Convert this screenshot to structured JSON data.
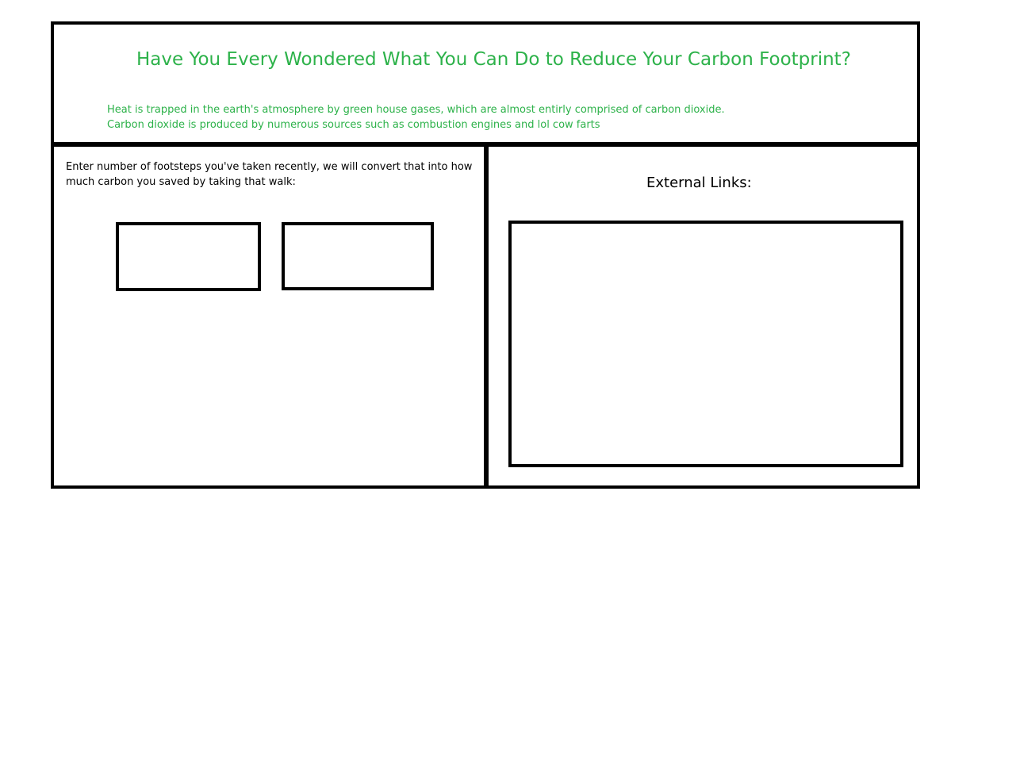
{
  "colors": {
    "accent_green": "#2db24a",
    "border": "#000000",
    "text": "#000000",
    "background": "#ffffff"
  },
  "header": {
    "title": "Have You Every Wondered What You Can Do to Reduce Your Carbon Footprint?",
    "intro_line_1": "Heat is trapped in the earth's atmosphere by green house gases, which are almost entirly comprised of carbon dioxide.",
    "intro_line_2": "Carbon dioxide is produced by numerous sources such as combustion engines and lol cow farts"
  },
  "calculator": {
    "prompt_line_1": "Enter number of footsteps you've taken recently, we will convert that into how",
    "prompt_line_2": "much carbon you saved by taking that walk:",
    "steps_value": "",
    "carbon_value": ""
  },
  "links": {
    "heading": "External Links:"
  }
}
